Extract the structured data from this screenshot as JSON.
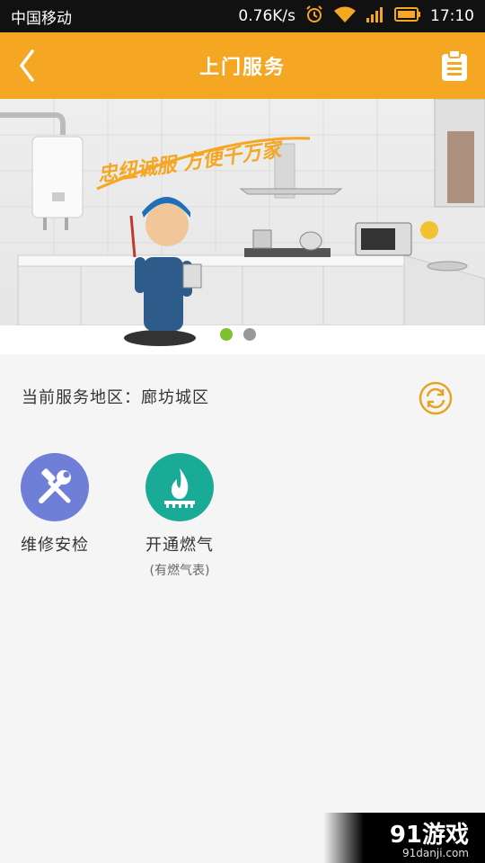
{
  "status_bar": {
    "carrier": "中国移动",
    "speed": "0.76K/s",
    "time": "17:10",
    "icons": [
      "alarm-icon",
      "wifi-icon",
      "signal-icon",
      "battery-icon"
    ]
  },
  "header": {
    "title": "上门服务",
    "back_icon": "chevron-left-icon",
    "action_icon": "clipboard-icon"
  },
  "banner": {
    "slogan": "忠纽诚服 方便千万家",
    "page_count": 2,
    "active_page": 1
  },
  "area": {
    "label": "当前服务地区：廊坊城区",
    "refresh_icon": "refresh-icon"
  },
  "services": [
    {
      "label": "维修安检",
      "sub": "",
      "icon": "tools-icon",
      "color": "#6f7fd8"
    },
    {
      "label": "开通燃气",
      "sub": "(有燃气表)",
      "icon": "flame-icon",
      "color": "#1aab97"
    }
  ],
  "watermark": {
    "logo": "91游戏",
    "url": "91danji.com"
  },
  "colors": {
    "accent": "#f5a623",
    "status_bar": "#111111",
    "dot_active": "#7cc22d",
    "dot_inactive": "#999999"
  }
}
